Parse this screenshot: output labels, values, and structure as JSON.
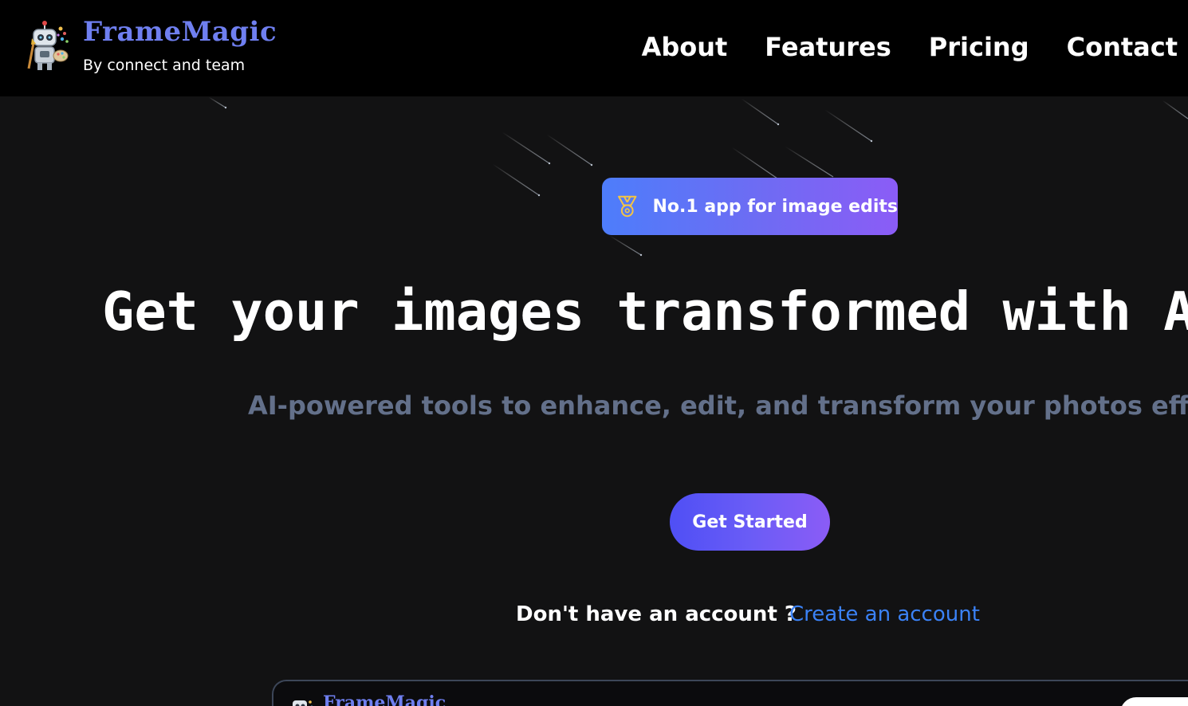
{
  "header": {
    "brand_title": "FrameMagic",
    "brand_subtitle": "By connect and team",
    "brand_color": "#6f7ff0",
    "nav": [
      {
        "label": "About"
      },
      {
        "label": "Features"
      },
      {
        "label": "Pricing"
      },
      {
        "label": "Contact"
      }
    ]
  },
  "badge": {
    "icon": "medal-icon",
    "text": "No.1 app for image edits"
  },
  "hero": {
    "title": "Get your images transformed with AI",
    "subtitle": "AI-powered tools to enhance, edit, and transform your photos effortlessly"
  },
  "cta": {
    "label": "Get Started"
  },
  "account": {
    "question": "Don't have an account ?",
    "link_label": "Create an account",
    "link_color": "#3b82f6"
  },
  "preview": {
    "title": "FrameMagic"
  },
  "colors": {
    "background": "#121213",
    "header_bg": "#000000",
    "badge_gradient_start": "#4d7dfb",
    "badge_gradient_end": "#8b5cf6",
    "subtitle": "#63708a"
  }
}
